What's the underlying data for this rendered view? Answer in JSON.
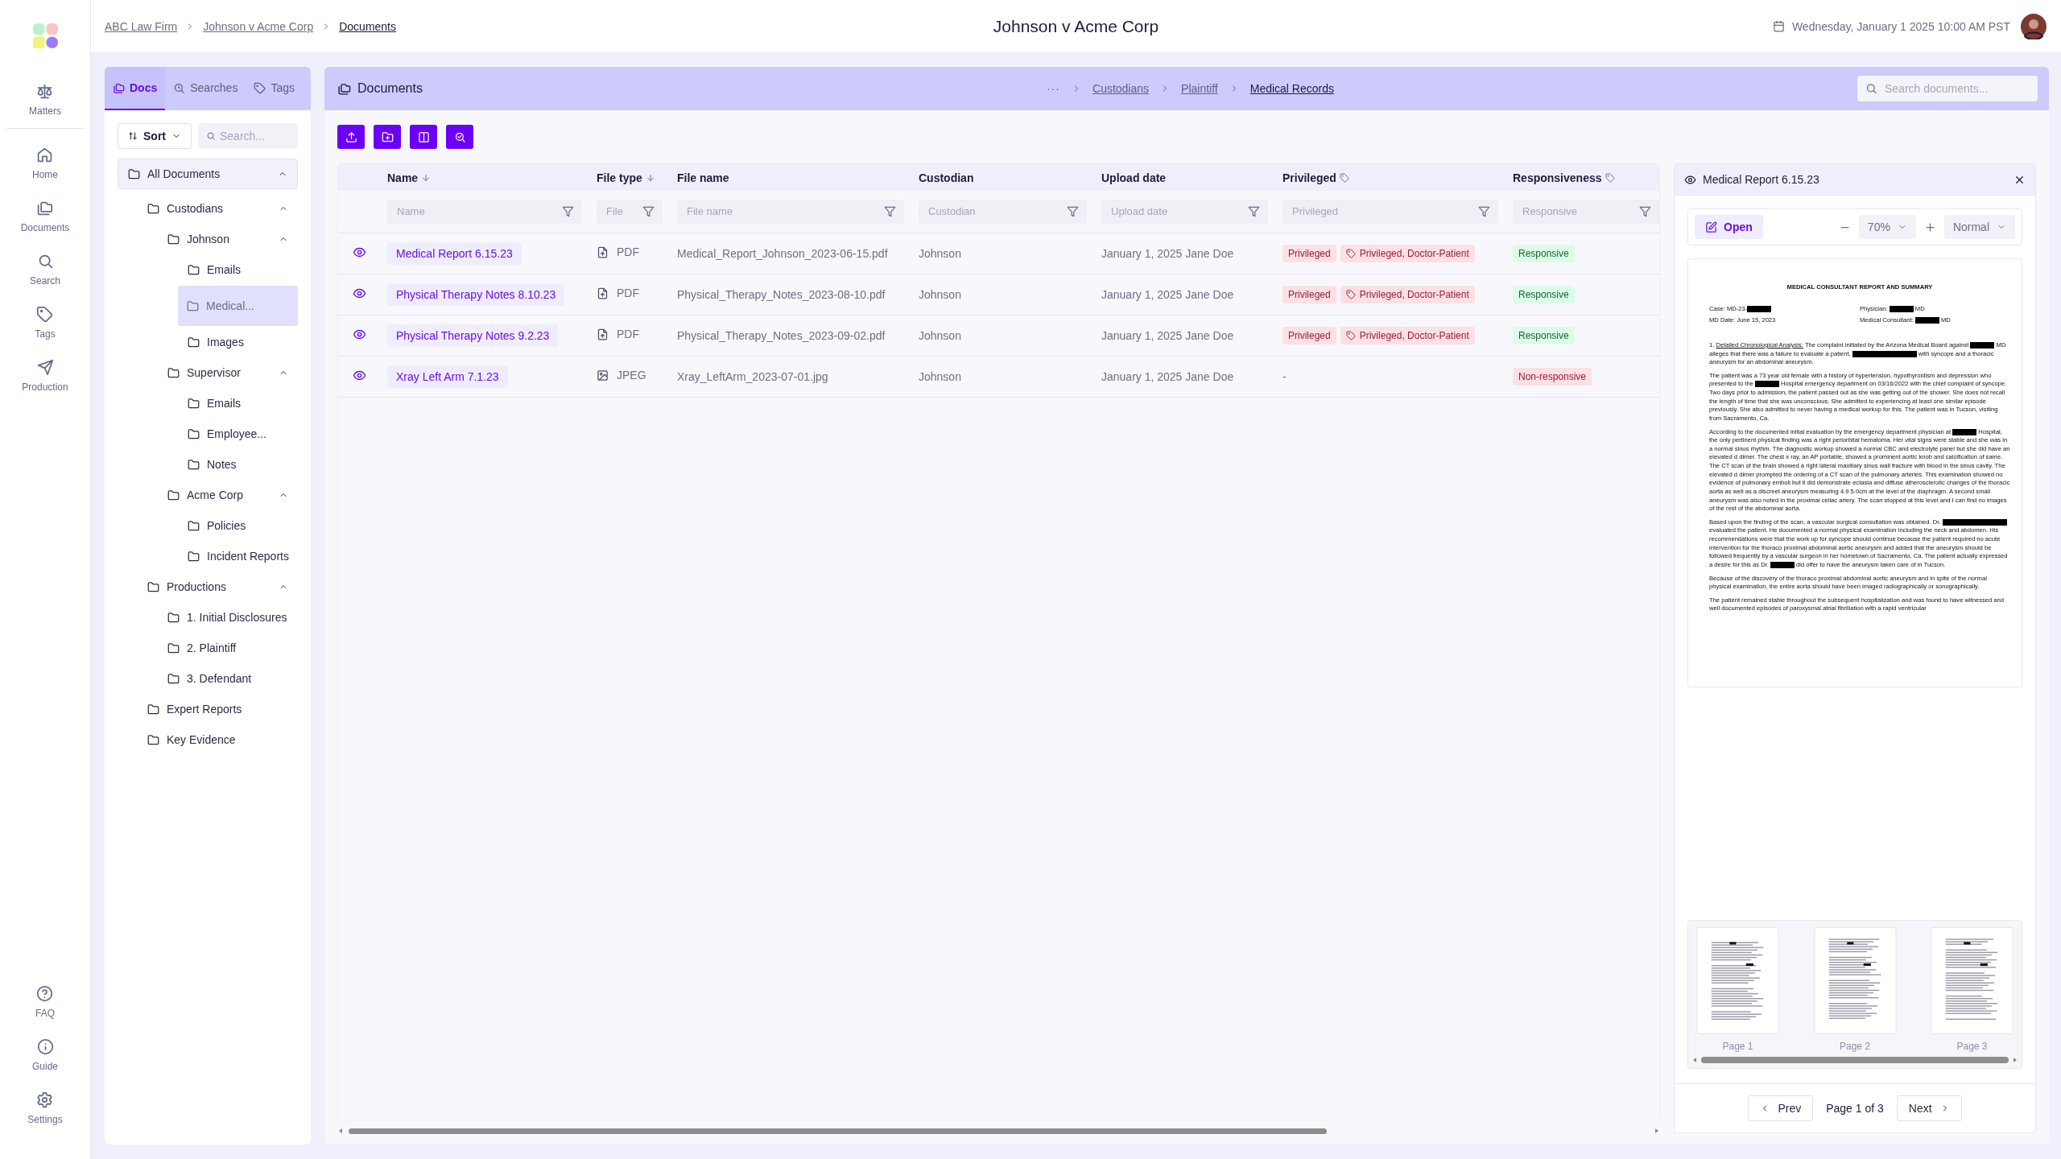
{
  "header": {
    "breadcrumbs": [
      "ABC Law Firm",
      "Johnson v Acme Corp",
      "Documents"
    ],
    "title": "Johnson v Acme Corp",
    "datetime": "Wednesday, January 1 2025 10:00 AM PST"
  },
  "rail": {
    "top": [
      {
        "label": "Matters"
      },
      {
        "label": "Home"
      },
      {
        "label": "Documents"
      },
      {
        "label": "Search"
      },
      {
        "label": "Tags"
      },
      {
        "label": "Production"
      }
    ],
    "bottom": [
      {
        "label": "FAQ"
      },
      {
        "label": "Guide"
      },
      {
        "label": "Settings"
      }
    ]
  },
  "left_panel": {
    "tabs": [
      {
        "label": "Docs",
        "selected": true
      },
      {
        "label": "Searches",
        "selected": false
      },
      {
        "label": "Tags",
        "selected": false
      }
    ],
    "sort": "Sort",
    "search_placeholder": "Search...",
    "tree": [
      {
        "label": "All Documents",
        "selected": false,
        "expanded": true,
        "children": [
          {
            "label": "Custodians",
            "selected": false,
            "expanded": true,
            "children": [
              {
                "label": "Johnson",
                "selected": false,
                "expanded": true,
                "children": [
                  {
                    "label": "Emails",
                    "selected": false
                  },
                  {
                    "label": "Medical...",
                    "selected": true
                  },
                  {
                    "label": "Images",
                    "selected": false
                  }
                ]
              },
              {
                "label": "Supervisor",
                "selected": false,
                "expanded": true,
                "children": [
                  {
                    "label": "Emails",
                    "selected": false
                  },
                  {
                    "label": "Employee...",
                    "selected": false
                  },
                  {
                    "label": "Notes",
                    "selected": false
                  }
                ]
              },
              {
                "label": "Acme Corp",
                "selected": false,
                "expanded": true,
                "children": [
                  {
                    "label": "Policies",
                    "selected": false
                  },
                  {
                    "label": "Incident Reports",
                    "selected": false
                  }
                ]
              }
            ]
          },
          {
            "label": "Productions",
            "selected": false,
            "expanded": true,
            "children": [
              {
                "label": "1. Initial Disclosures",
                "selected": false
              },
              {
                "label": "2. Plaintiff",
                "selected": false
              },
              {
                "label": "3. Defendant",
                "selected": false
              }
            ]
          },
          {
            "label": "Expert Reports",
            "selected": false
          },
          {
            "label": "Key Evidence",
            "selected": false
          }
        ]
      }
    ]
  },
  "documents": {
    "title": "Documents",
    "breadcrumbs": [
      "···",
      "Custodians",
      "Plaintiff",
      "Medical Records"
    ],
    "search_placeholder": "Search documents...",
    "columns": [
      {
        "label": "Name",
        "sorted": true,
        "placeholder": "Name"
      },
      {
        "label": "File type",
        "sorted": true,
        "placeholder": "File"
      },
      {
        "label": "File name",
        "sorted": false,
        "placeholder": "File name"
      },
      {
        "label": "Custodian",
        "sorted": false,
        "placeholder": "Custodian"
      },
      {
        "label": "Upload date",
        "sorted": false,
        "placeholder": "Upload date"
      },
      {
        "label": "Privileged",
        "sorted": false,
        "tag": true,
        "placeholder": "Privileged"
      },
      {
        "label": "Responsiveness",
        "sorted": false,
        "tag": true,
        "placeholder": "Responsive"
      }
    ],
    "rows": [
      {
        "name": "Medical Report 6.15.23",
        "kind": "document",
        "file_type": "PDF",
        "file_name": "Medical_Report_Johnson_2023-06-15.pdf",
        "custodian": "Johnson",
        "upload_date": "January 1, 2025 Jane Doe",
        "privileged": [
          {
            "kind": "badge",
            "label": "Privileged"
          },
          {
            "kind": "tag",
            "label": "Privileged, Doctor-Patient"
          }
        ],
        "responsiveness": {
          "label": "Responsive",
          "responsive": true
        }
      },
      {
        "name": "Physical Therapy Notes 8.10.23",
        "kind": "document",
        "file_type": "PDF",
        "file_name": "Physical_Therapy_Notes_2023-08-10.pdf",
        "custodian": "Johnson",
        "upload_date": "January 1, 2025 Jane Doe",
        "privileged": [
          {
            "kind": "badge",
            "label": "Privileged"
          },
          {
            "kind": "tag",
            "label": "Privileged, Doctor-Patient"
          }
        ],
        "responsiveness": {
          "label": "Responsive",
          "responsive": true
        }
      },
      {
        "name": "Physical Therapy Notes 9.2.23",
        "kind": "document",
        "file_type": "PDF",
        "file_name": "Physical_Therapy_Notes_2023-09-02.pdf",
        "custodian": "Johnson",
        "upload_date": "January 1, 2025 Jane Doe",
        "privileged": [
          {
            "kind": "badge",
            "label": "Privileged"
          },
          {
            "kind": "tag",
            "label": "Privileged, Doctor-Patient"
          }
        ],
        "responsiveness": {
          "label": "Responsive",
          "responsive": true
        }
      },
      {
        "name": "Xray Left Arm 7.1.23",
        "kind": "image",
        "file_type": "JPEG",
        "file_name": "Xray_LeftArm_2023-07-01.jpg",
        "custodian": "Johnson",
        "upload_date": "January 1, 2025 Jane Doe",
        "privileged": [
          {
            "kind": "none",
            "label": "-"
          }
        ],
        "responsiveness": {
          "label": "Non-responsive",
          "responsive": false
        }
      }
    ]
  },
  "preview": {
    "title": "Medical Report 6.15.23",
    "open": "Open",
    "zoom": "70%",
    "mode": "Normal",
    "document": {
      "title": "MEDICAL CONSULTANT REPORT AND SUMMARY",
      "meta": [
        [
          {
            "text": "Case:  MD-23-"
          },
          {
            "kind": "redaction"
          }
        ],
        [
          {
            "text": "Physician: "
          },
          {
            "kind": "redaction"
          },
          {
            "text": " MD"
          }
        ],
        [
          {
            "text": "MD  Date:  June 15, 2023"
          }
        ],
        [
          {
            "text": "Medical Consultant: "
          },
          {
            "kind": "redaction"
          },
          {
            "text": " MD"
          }
        ]
      ],
      "paragraphs": [
        [
          {
            "text": "1. "
          },
          {
            "kind": "underline",
            "text": "Detailed Chronological Analysis:"
          },
          {
            "text": " The complaint initiated by the Arizona Medical Board against "
          },
          {
            "kind": "redaction"
          },
          {
            "text": " MD alleges that there was a failure to evaluate a patient, "
          },
          {
            "kind": "redaction",
            "wide": true
          },
          {
            "text": " with syncope and a thoracic aneurysm for an abdominal aneurysm."
          }
        ],
        [
          {
            "text": "The patient was a 73 year old female with a history of hypertension, hypothyroidism and depression who presented to the "
          },
          {
            "kind": "redaction"
          },
          {
            "text": " Hospital emergency department on 03/16/2022 with the chief complaint of syncope. Two days prior to admission, the patient passed out as she was getting out of the shower. She does not recall the length of time that she was unconscious. She admitted to experiencing at least one similar episode previously. She also admitted to never having a medical workup for this. The patient was in Tucson, visiting from Sacramento, Ca."
          }
        ],
        [
          {
            "text": "According to the documented initial evaluation by the emergency department physician at "
          },
          {
            "kind": "redaction"
          },
          {
            "text": " Hospital, the only pertinent physical finding was a right periorbital hematoma. Her vital signs were stable and she was in a normal sinus rhythm. The diagnostic workup showed a normal CBC and electrolyte panel but she did have an elevated d dimer. The chest x ray, an AP portable, showed a prominent aortic knob and calcification of same. The CT scan of the brain showed a right lateral maxillary sinus wall fracture with blood in the sinus cavity. The elevated d dimer prompted the ordering of a CT scan of the pulmonary arteries. This examination showed no evidence of pulmonary emboli but it did demonstrate ectasia and diffuse atherosclerotic changes of the thoracic aorta as well as a discreet aneurysm measuring 4.9 5.0cm at the level of the diaphragm. A second small aneurysm was also noted in the proximal celiac artery. The scan stopped at this level and I can find no images of the rest of the abdominal aorta."
          }
        ],
        [
          {
            "text": "Based upon the finding of the scan, a vascular surgical consultation was obtained. Dr. "
          },
          {
            "kind": "redaction",
            "wide": true
          },
          {
            "text": " evaluated the patient. He documented a normal physical examination including the neck and abdomen. His recommendations were that the work up for syncope should continue because the patient required no acute intervention for the thoraco proximal abdominal aortic aneurysm and added that the aneurysm should be followed frequently by a vascular surgeon in her hometown of Sacramento, Ca. The patient actually expressed a desire for this as Dr. "
          },
          {
            "kind": "redaction"
          },
          {
            "text": " did offer to have the aneurysm taken care of in Tucson."
          }
        ],
        [
          {
            "text": "Because of the discovery of the thoraco proximal abdominal aortic aneurysm and in spite of the normal physical examination, the entire aorta should have been imaged radiographically or sonographically."
          }
        ],
        [
          {
            "text": "The patient remained stable throughout the subsequent hospitalization and was found to have witnessed and well documented episodes of paroxysmal atrial fibrillation with a rapid ventricular"
          }
        ]
      ]
    },
    "thumbnails": [
      {
        "label": "Page 1"
      },
      {
        "label": "Page 2"
      },
      {
        "label": "Page 3"
      }
    ],
    "pager": {
      "prev": "Prev",
      "status": "Page 1 of 3",
      "next": "Next"
    }
  }
}
